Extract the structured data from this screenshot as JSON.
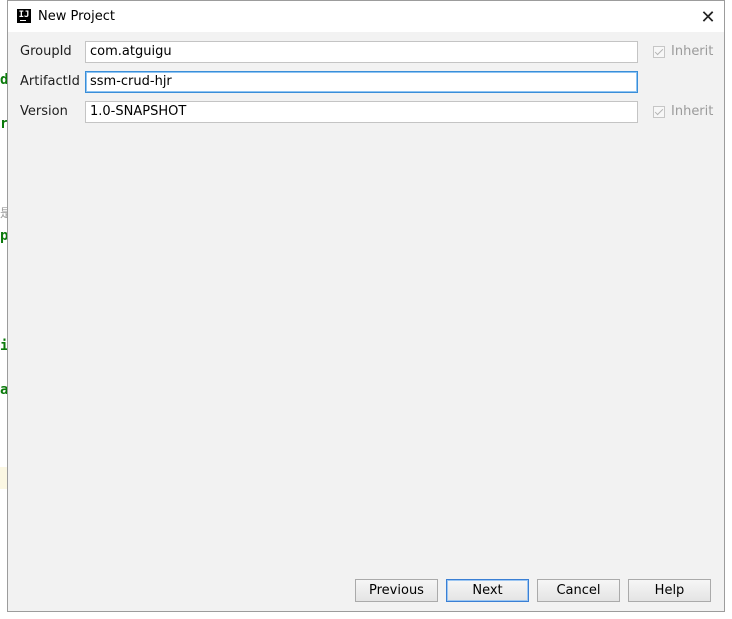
{
  "window": {
    "title": "New Project"
  },
  "background": {
    "fragments": [
      "d",
      "r",
      "是",
      "p",
      "i",
      "a"
    ]
  },
  "form": {
    "group_id": {
      "label": "GroupId",
      "value": "com.atguigu",
      "inherit_label": "Inherit"
    },
    "artifact_id": {
      "label": "ArtifactId",
      "value": "ssm-crud-hjr"
    },
    "version": {
      "label": "Version",
      "value": "1.0-SNAPSHOT",
      "inherit_label": "Inherit"
    }
  },
  "buttons": {
    "previous": "Previous",
    "next": "Next",
    "cancel": "Cancel",
    "help": "Help"
  },
  "icons": {
    "app": "intellij-icon",
    "close": "close-icon",
    "check": "check-icon"
  },
  "colors": {
    "focus_border": "#3a8ed8",
    "default_button_border": "#3a7fd4",
    "background_code": "#0b7a0b"
  }
}
